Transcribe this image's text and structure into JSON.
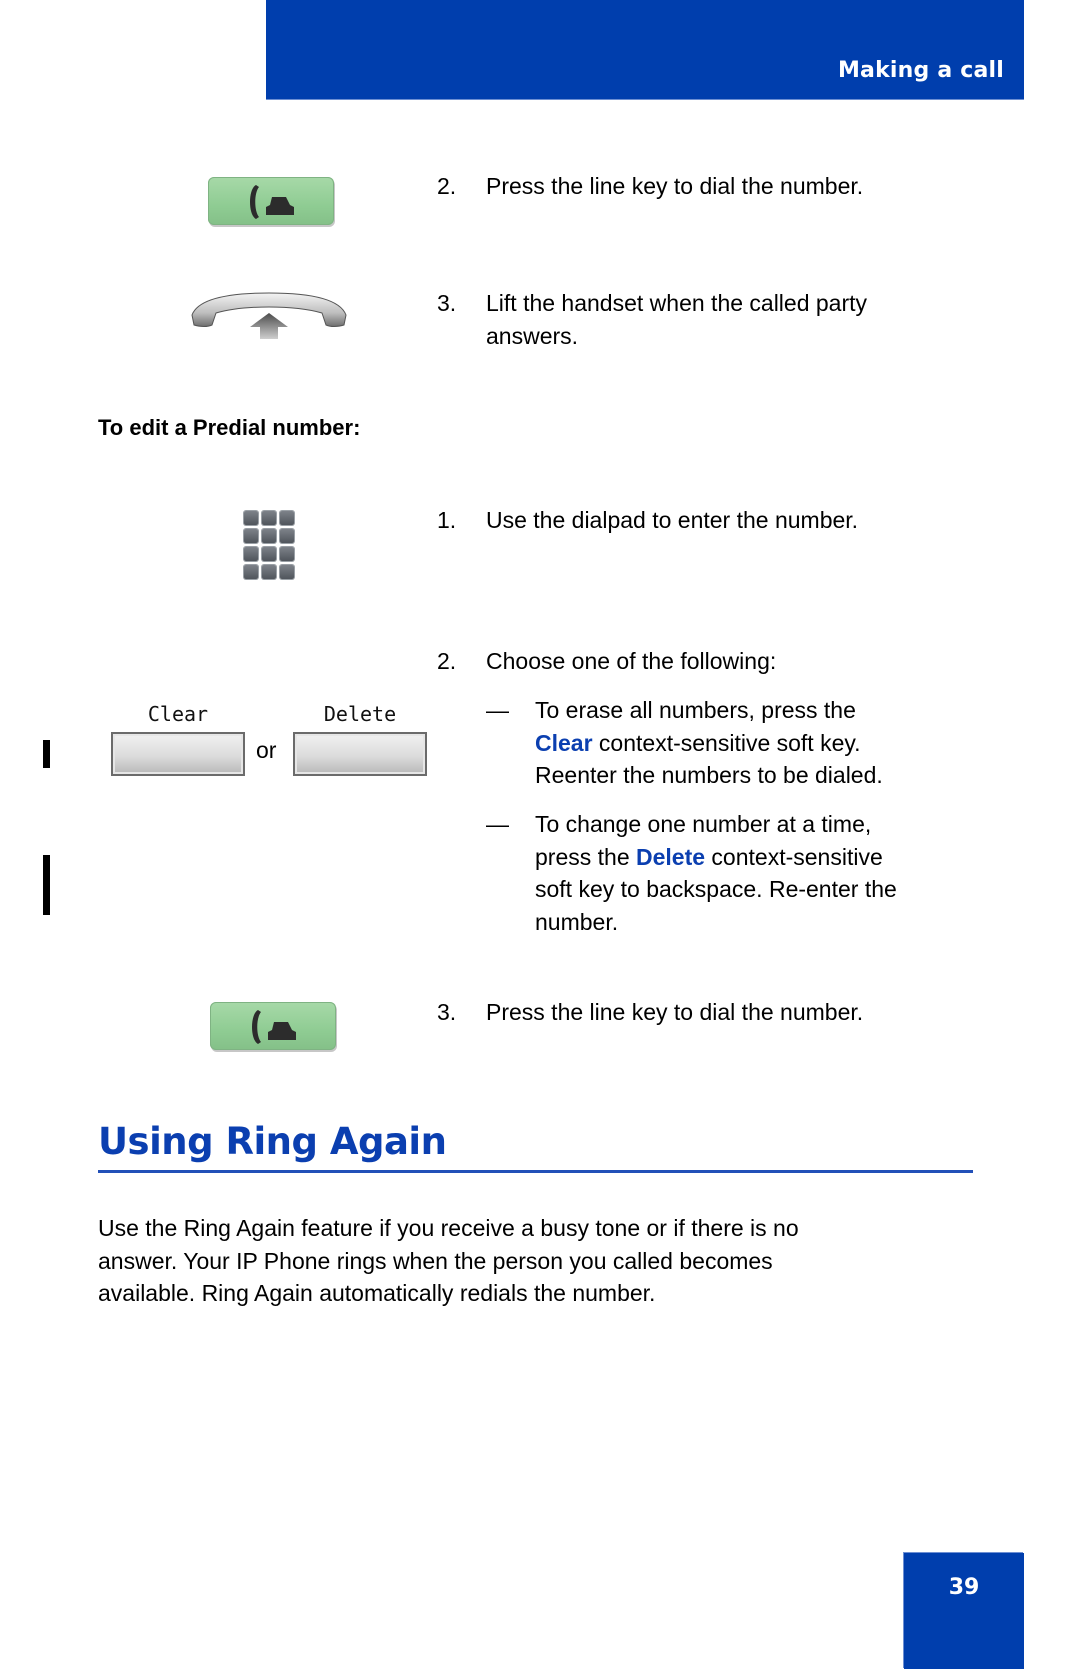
{
  "header": {
    "section_title": "Making a call"
  },
  "make_call_steps": [
    {
      "number": "2.",
      "icon": "line-key-icon",
      "text": "Press the line key to dial the number."
    },
    {
      "number": "3.",
      "icon": "handset-lift-icon",
      "text_lines": [
        "Lift the handset when the called party",
        "answers."
      ]
    }
  ],
  "edit_predial": {
    "subheading": "To edit a Predial number:",
    "step1": {
      "number": "1.",
      "icon": "dialpad-icon",
      "text": "Use the dialpad to enter the number."
    },
    "step2": {
      "number": "2.",
      "text": "Choose one of the following:",
      "softkeys": {
        "clear_label": "Clear",
        "or_text": "or",
        "delete_label": "Delete"
      },
      "options": [
        {
          "dash": "—",
          "line1": "To erase all numbers, press the",
          "line2_key": "Clear",
          "line2_rest": " context-sensitive soft key.",
          "line3": "Reenter the numbers to be dialed."
        },
        {
          "dash": "—",
          "line1": "To change one number at a time,",
          "line2_pre": "press the ",
          "line2_key": "Delete",
          "line2_rest": " context-sensitive",
          "line3": "soft key to backspace. Re-enter the",
          "line4": "number."
        }
      ]
    },
    "step3": {
      "number": "3.",
      "icon": "line-key-icon",
      "text": "Press the line key to dial the number."
    }
  },
  "ring_again": {
    "heading": "Using Ring Again",
    "paragraph_lines": [
      "Use the Ring Again feature if you receive a busy tone or if there is no",
      "answer. Your IP Phone rings when the person you called becomes",
      "available. Ring Again automatically redials the number."
    ]
  },
  "footer": {
    "page_number": "39"
  },
  "colors": {
    "brand_blue": "#003ead",
    "key_label_blue": "#0b3fb0",
    "line_key_green": "#8fcc93"
  }
}
